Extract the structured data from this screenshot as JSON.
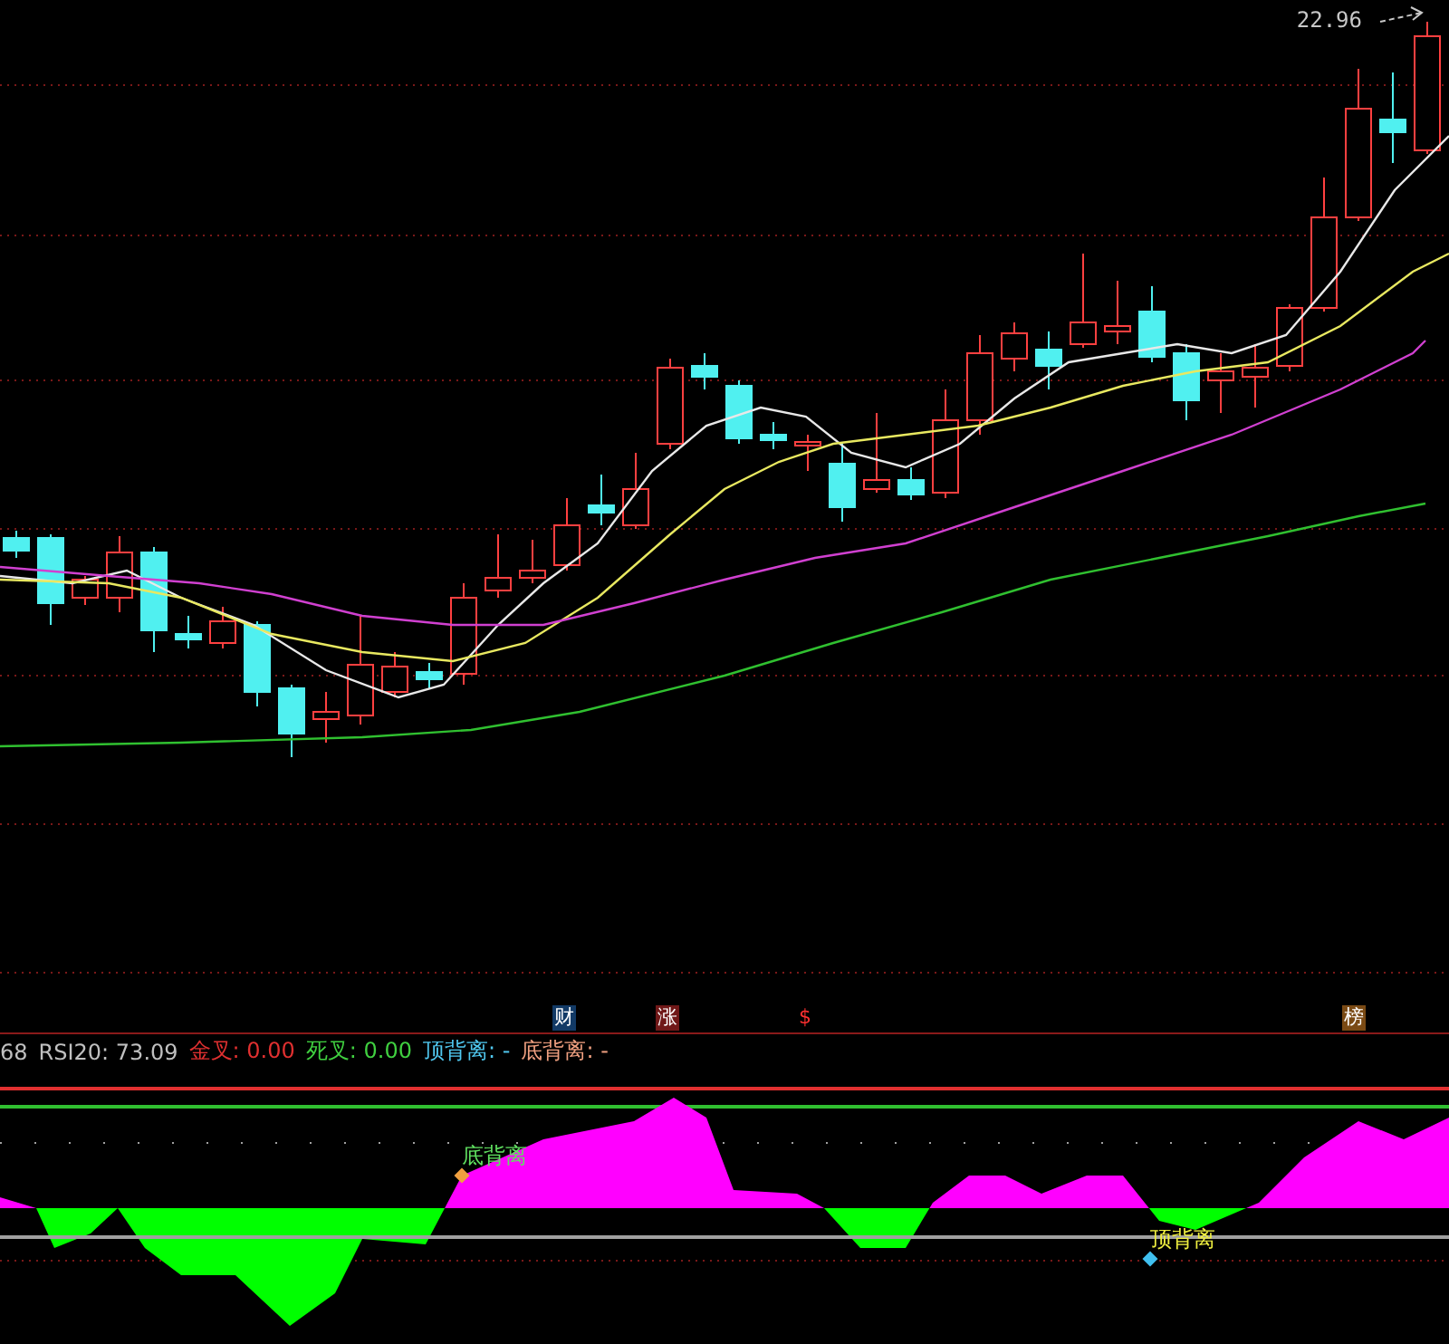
{
  "price_label": "22.96",
  "event_markers": [
    {
      "label": "财",
      "color": "#123a66"
    },
    {
      "label": "涨",
      "color": "#701818"
    },
    {
      "label": "$",
      "color": "#000000"
    },
    {
      "label": "榜",
      "color": "#7a4a14"
    }
  ],
  "indicator_bar": {
    "cut_prefix": "68",
    "items": [
      {
        "label": "RSI20:",
        "value": "73.09",
        "color": "#c0c0c0"
      },
      {
        "label": "金叉:",
        "value": "0.00",
        "color": "#e03030"
      },
      {
        "label": "死叉:",
        "value": "0.00",
        "color": "#40d040"
      },
      {
        "label": "顶背离:",
        "value": "-",
        "color": "#50c8f0"
      },
      {
        "label": "底背离:",
        "value": "-",
        "color": "#f0a080"
      }
    ]
  },
  "annotations": [
    {
      "label": "底背离",
      "color": "#60e060"
    },
    {
      "label": "顶背离",
      "color": "#f0f040"
    }
  ]
}
